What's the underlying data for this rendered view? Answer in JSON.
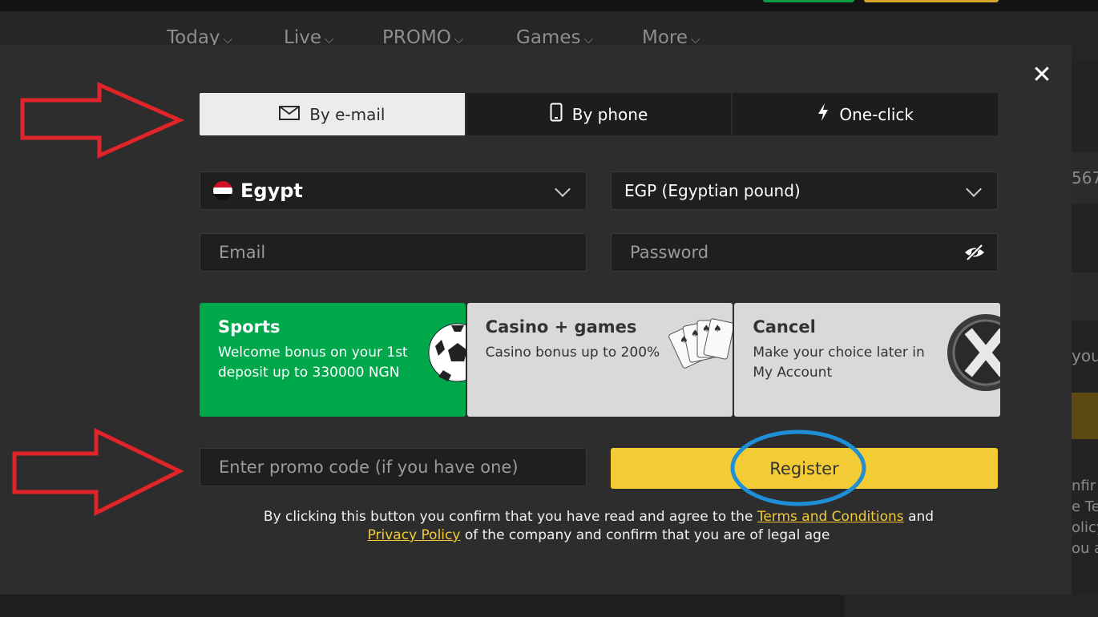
{
  "background": {
    "nav": [
      {
        "label": "Today"
      },
      {
        "label": "Live"
      },
      {
        "label": "PROMO"
      },
      {
        "label": "Games"
      },
      {
        "label": "More"
      }
    ],
    "side_texts": [
      "567",
      "you",
      "nfir",
      "e Ter",
      "olicy",
      "ou a"
    ]
  },
  "modal": {
    "close_icon": "close-icon",
    "tabs": [
      {
        "label": "By e-mail",
        "icon": "envelope-icon"
      },
      {
        "label": "By phone",
        "icon": "phone-icon"
      },
      {
        "label": "One-click",
        "icon": "lightning-icon"
      }
    ],
    "country": {
      "value": "Egypt"
    },
    "currency": {
      "value": "EGP (Egyptian pound)"
    },
    "email": {
      "placeholder": "Email"
    },
    "password": {
      "placeholder": "Password",
      "icon": "eye-hidden-icon"
    },
    "bonus_cards": [
      {
        "title": "Sports",
        "desc": "Welcome bonus on your 1st deposit up to 330000 NGN"
      },
      {
        "title": "Casino + games",
        "desc": "Casino bonus up to 200%"
      },
      {
        "title": "Cancel",
        "desc": "Make your choice later in My Account"
      }
    ],
    "promo": {
      "placeholder": "Enter promo code (if you have one)"
    },
    "register_label": "Register",
    "disclaimer": {
      "part1": "By clicking this button you confirm that you have read and agree to the ",
      "terms_link": "Terms and Conditions",
      "part2": " and",
      "privacy_link": "Privacy Policy",
      "part3": " of the company and confirm that you are of legal age"
    }
  },
  "colors": {
    "accent_yellow": "#f2cb35",
    "sports_green": "#01a84b",
    "annotation_red": "#e0242a",
    "annotation_blue": "#1e8fd6"
  }
}
